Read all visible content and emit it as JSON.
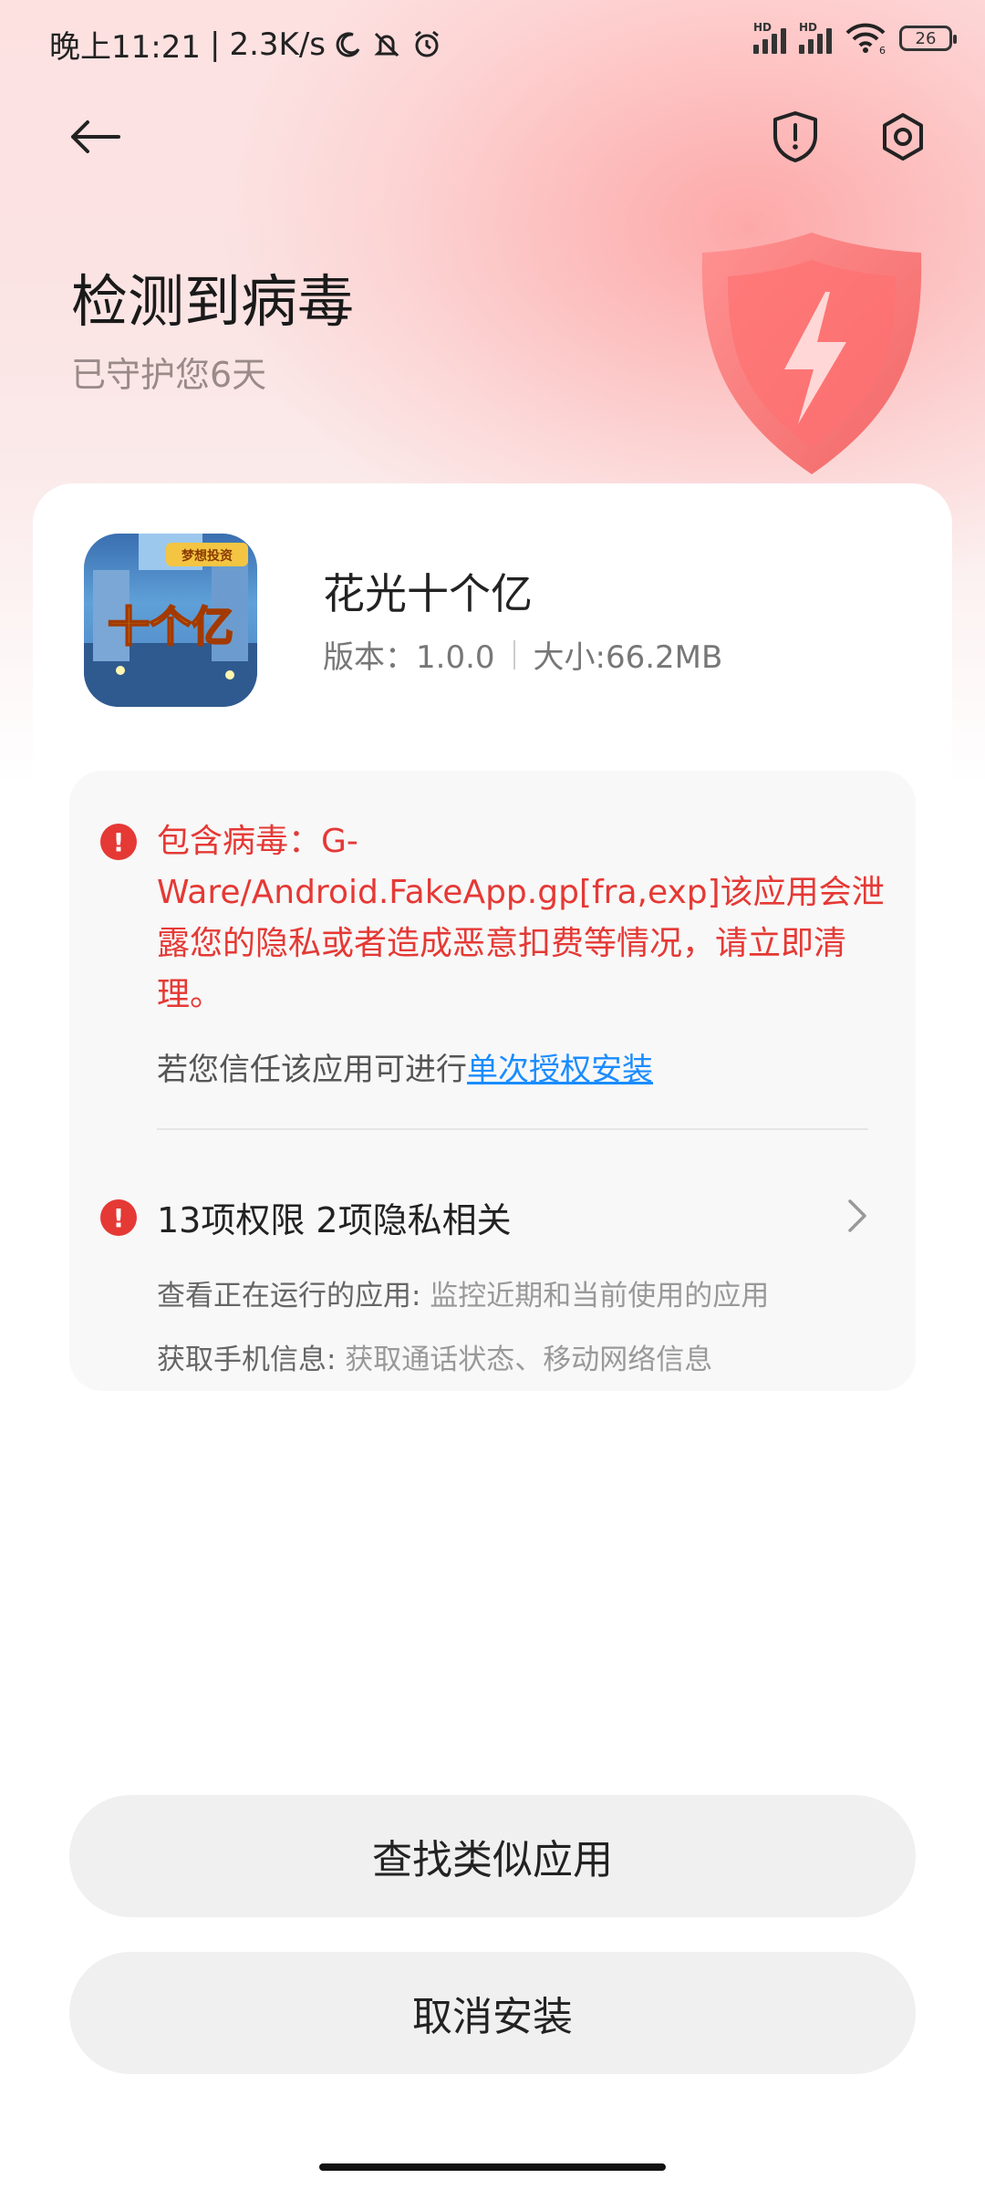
{
  "status_bar": {
    "time": "晚上11:21",
    "speed": "2.3K/s",
    "signal_label_1": "HD",
    "signal_label_2": "HD",
    "wifi_label": "6",
    "battery": "26"
  },
  "header": {
    "title": "检测到病毒",
    "subtitle": "已守护您6天"
  },
  "app": {
    "name": "花光十个亿",
    "version": "版本：1.0.0",
    "size": "大小:66.2MB",
    "icon_text": "十个亿",
    "icon_banner": "梦想投资"
  },
  "warning": {
    "virus_text": "包含病毒：G-Ware/Android.FakeApp.gp[fra,exp]该应用会泄露您的隐私或者造成恶意扣费等情况，请立即清理。",
    "trust_prefix": "若您信任该应用可进行",
    "trust_link": "单次授权安装"
  },
  "permissions": {
    "title": "13项权限 2项隐私相关",
    "items": [
      {
        "name": "查看正在运行的应用:",
        "desc": " 监控近期和当前使用的应用"
      },
      {
        "name": "获取手机信息:",
        "desc": " 获取通话状态、移动网络信息"
      }
    ]
  },
  "buttons": {
    "find_similar": "查找类似应用",
    "cancel_install": "取消安装"
  },
  "colors": {
    "danger": "#e53935",
    "link": "#1a8cff",
    "button_bg": "#f0f0f0"
  }
}
